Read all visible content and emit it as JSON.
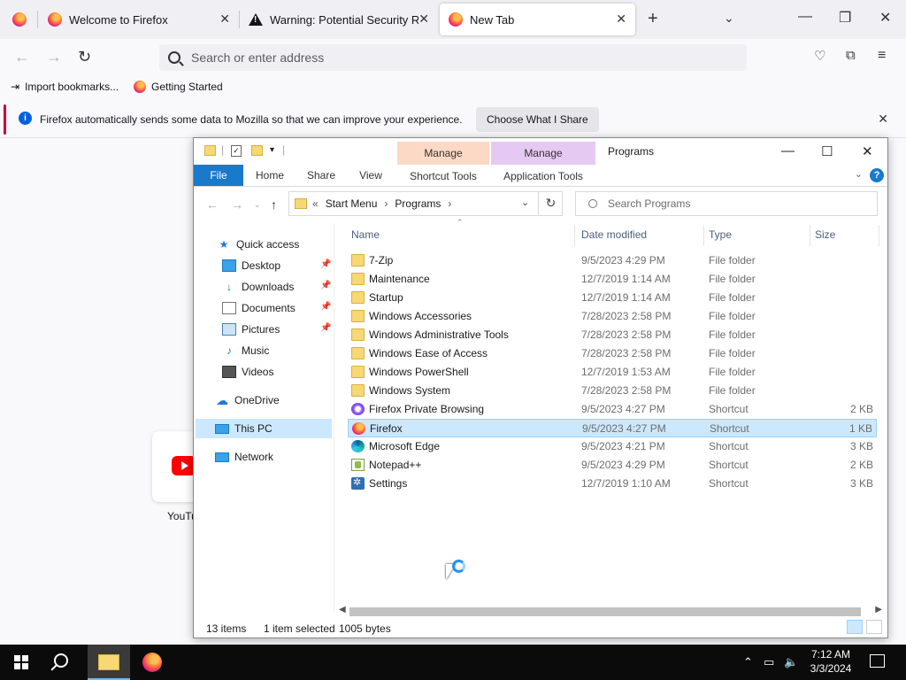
{
  "browser": {
    "tabs": [
      {
        "label": "Welcome to Firefox",
        "icon": "firefox-icon"
      },
      {
        "label": "Warning: Potential Security Risk",
        "icon": "warning-icon"
      },
      {
        "label": "New Tab",
        "icon": "firefox-icon",
        "active": true
      }
    ],
    "search_placeholder": "Search or enter address",
    "bookmarks": [
      {
        "label": "Import bookmarks...",
        "icon": "import-icon"
      },
      {
        "label": "Getting Started",
        "icon": "firefox-icon"
      }
    ],
    "notice": {
      "text": "Firefox automatically sends some data to Mozilla so that we can improve your experience.",
      "button": "Choose What I Share"
    },
    "top_site_label": "YouTu"
  },
  "explorer": {
    "title": "Programs",
    "ribbon": {
      "tabs": [
        "File",
        "Home",
        "Share",
        "View"
      ],
      "manage_shortcut": {
        "header": "Manage",
        "label": "Shortcut Tools",
        "color": "#fbd9c4"
      },
      "manage_app": {
        "header": "Manage",
        "label": "Application Tools",
        "color": "#e6c9f2"
      }
    },
    "address": {
      "prefix": "«",
      "crumbs": [
        "Start Menu",
        "Programs"
      ]
    },
    "search_placeholder": "Search Programs",
    "nav": {
      "quick_access": "Quick access",
      "items": [
        {
          "label": "Desktop",
          "pinned": true
        },
        {
          "label": "Downloads",
          "pinned": true
        },
        {
          "label": "Documents",
          "pinned": true
        },
        {
          "label": "Pictures",
          "pinned": true
        },
        {
          "label": "Music",
          "pinned": false
        },
        {
          "label": "Videos",
          "pinned": false
        }
      ],
      "onedrive": "OneDrive",
      "this_pc": "This PC",
      "network": "Network"
    },
    "columns": {
      "name": "Name",
      "date": "Date modified",
      "type": "Type",
      "size": "Size"
    },
    "files": [
      {
        "name": "7-Zip",
        "date": "9/5/2023 4:29 PM",
        "type": "File folder",
        "size": "",
        "icon": "folder"
      },
      {
        "name": "Maintenance",
        "date": "12/7/2019 1:14 AM",
        "type": "File folder",
        "size": "",
        "icon": "folder"
      },
      {
        "name": "Startup",
        "date": "12/7/2019 1:14 AM",
        "type": "File folder",
        "size": "",
        "icon": "folder"
      },
      {
        "name": "Windows Accessories",
        "date": "7/28/2023 2:58 PM",
        "type": "File folder",
        "size": "",
        "icon": "folder"
      },
      {
        "name": "Windows Administrative Tools",
        "date": "7/28/2023 2:58 PM",
        "type": "File folder",
        "size": "",
        "icon": "folder"
      },
      {
        "name": "Windows Ease of Access",
        "date": "7/28/2023 2:58 PM",
        "type": "File folder",
        "size": "",
        "icon": "folder"
      },
      {
        "name": "Windows PowerShell",
        "date": "12/7/2019 1:53 AM",
        "type": "File folder",
        "size": "",
        "icon": "folder"
      },
      {
        "name": "Windows System",
        "date": "7/28/2023 2:58 PM",
        "type": "File folder",
        "size": "",
        "icon": "folder"
      },
      {
        "name": "Firefox Private Browsing",
        "date": "9/5/2023 4:27 PM",
        "type": "Shortcut",
        "size": "2 KB",
        "icon": "ffp"
      },
      {
        "name": "Firefox",
        "date": "9/5/2023 4:27 PM",
        "type": "Shortcut",
        "size": "1 KB",
        "icon": "ff",
        "selected": true
      },
      {
        "name": "Microsoft Edge",
        "date": "9/5/2023 4:21 PM",
        "type": "Shortcut",
        "size": "3 KB",
        "icon": "edge"
      },
      {
        "name": "Notepad++",
        "date": "9/5/2023 4:29 PM",
        "type": "Shortcut",
        "size": "2 KB",
        "icon": "npp"
      },
      {
        "name": "Settings",
        "date": "12/7/2019 1:10 AM",
        "type": "Shortcut",
        "size": "3 KB",
        "icon": "gear"
      }
    ],
    "status": {
      "items": "13 items",
      "selected": "1 item selected",
      "bytes": "1005 bytes"
    }
  },
  "taskbar": {
    "time": "7:12 AM",
    "date": "3/3/2024"
  }
}
